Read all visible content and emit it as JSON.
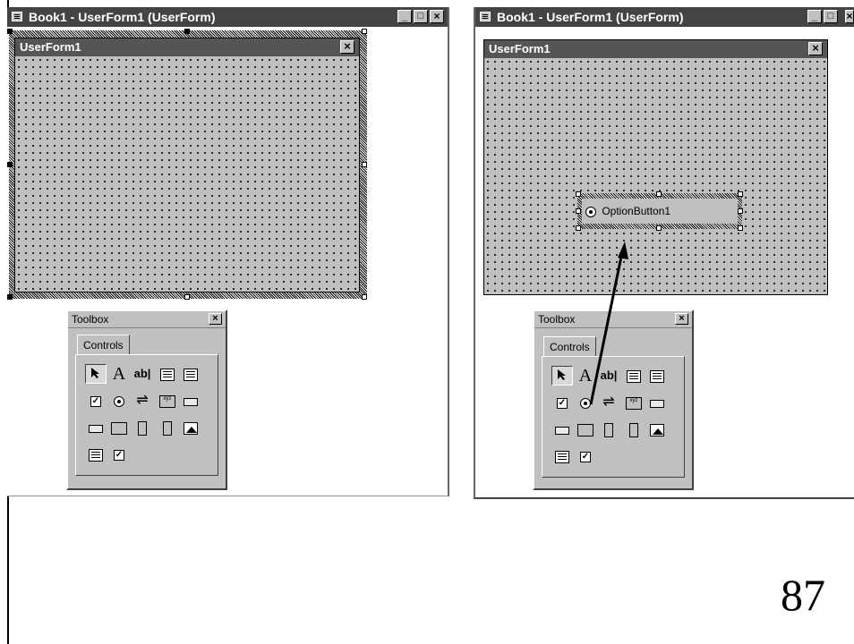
{
  "left": {
    "window_title": "Book1 - UserForm1 (UserForm)",
    "form_title": "UserForm1",
    "toolbox": {
      "title": "Toolbox",
      "tab_label": "Controls"
    }
  },
  "right": {
    "window_title": "Book1 - UserForm1 (UserForm)",
    "form_title": "UserForm1",
    "option_button_label": "OptionButton1",
    "toolbox": {
      "title": "Toolbox",
      "tab_label": "Controls"
    }
  },
  "tools": {
    "label_glyph": "A",
    "textbox_glyph": "ab|",
    "checkbox_glyph": "✓",
    "frame_glyph": "xyz"
  },
  "buttons": {
    "minimize": "_",
    "maximize": "□",
    "close": "×"
  },
  "page_number": "87",
  "colors": {
    "titlebar": "#444444",
    "form_bg": "#c0c0c0",
    "grid_dot": "#111111"
  }
}
